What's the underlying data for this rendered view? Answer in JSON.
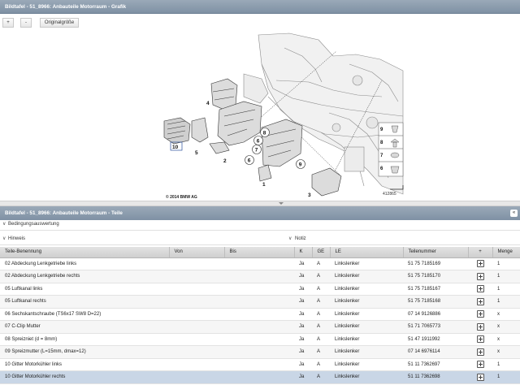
{
  "window": {
    "graphic_title": "Bildtafel - 51_8966: Anbauteile Motorraum - Grafik",
    "parts_title": "Bildtafel - 51_8966: Anbauteile Motorraum - Teile"
  },
  "toolbar": {
    "zoom_in": "+",
    "zoom_out": "-",
    "original_size": "Originalgröße"
  },
  "graphic": {
    "copyright": "© 2014 BMW AG",
    "image_id": "412865",
    "callouts": [
      "4",
      "10",
      "5",
      "2",
      "8",
      "6",
      "7",
      "1",
      "9",
      "3"
    ],
    "legend": [
      "9",
      "8",
      "7",
      "6"
    ]
  },
  "parts_panel": {
    "collapse_label": "«",
    "filters": {
      "conditions": "Bedingungsauswertung",
      "hint": "Hinweis",
      "note": "Notiz"
    },
    "columns": [
      "Teile-Benennung",
      "Von",
      "Bis",
      "K",
      "GE",
      "LE",
      "Teilenummer",
      "+",
      "Menge"
    ],
    "rows": [
      {
        "name": "02 Abdeckung Lenkgetriebe links",
        "von": "",
        "bis": "",
        "k": "Ja",
        "ge": "A",
        "le": "Linkslenker",
        "part": "51 75 7185169",
        "qty": "1"
      },
      {
        "name": "02 Abdeckung Lenkgetriebe rechts",
        "von": "",
        "bis": "",
        "k": "Ja",
        "ge": "A",
        "le": "Linkslenker",
        "part": "51 75 7185170",
        "qty": "1"
      },
      {
        "name": "05 Luftkanal links",
        "von": "",
        "bis": "",
        "k": "Ja",
        "ge": "A",
        "le": "Linkslenker",
        "part": "51 75 7185167",
        "qty": "1"
      },
      {
        "name": "05 Luftkanal rechts",
        "von": "",
        "bis": "",
        "k": "Ja",
        "ge": "A",
        "le": "Linkslenker",
        "part": "51 75 7185168",
        "qty": "1"
      },
      {
        "name": "06 Sechskantschraube (TS6x17 SW8 D=22)",
        "von": "",
        "bis": "",
        "k": "Ja",
        "ge": "A",
        "le": "Linkslenker",
        "part": "07 14 9126886",
        "qty": "x"
      },
      {
        "name": "07 C-Clip Mutter",
        "von": "",
        "bis": "",
        "k": "Ja",
        "ge": "A",
        "le": "Linkslenker",
        "part": "51 71 7065773",
        "qty": "x"
      },
      {
        "name": "08 Spreizniet (d = 8mm)",
        "von": "",
        "bis": "",
        "k": "Ja",
        "ge": "A",
        "le": "Linkslenker",
        "part": "51 47 1911992",
        "qty": "x"
      },
      {
        "name": "09 Spreizmutter (L=15mm, dmax=12)",
        "von": "",
        "bis": "",
        "k": "Ja",
        "ge": "A",
        "le": "Linkslenker",
        "part": "07 14 6976114",
        "qty": "x"
      },
      {
        "name": "10 Gitter Motorkühler links",
        "von": "",
        "bis": "",
        "k": "Ja",
        "ge": "A",
        "le": "Linkslenker",
        "part": "51 11 7362697",
        "qty": "1"
      },
      {
        "name": "10 Gitter Motorkühler rechts",
        "von": "",
        "bis": "",
        "k": "Ja",
        "ge": "A",
        "le": "Linkslenker",
        "part": "51 11 7362698",
        "qty": "1"
      }
    ]
  }
}
